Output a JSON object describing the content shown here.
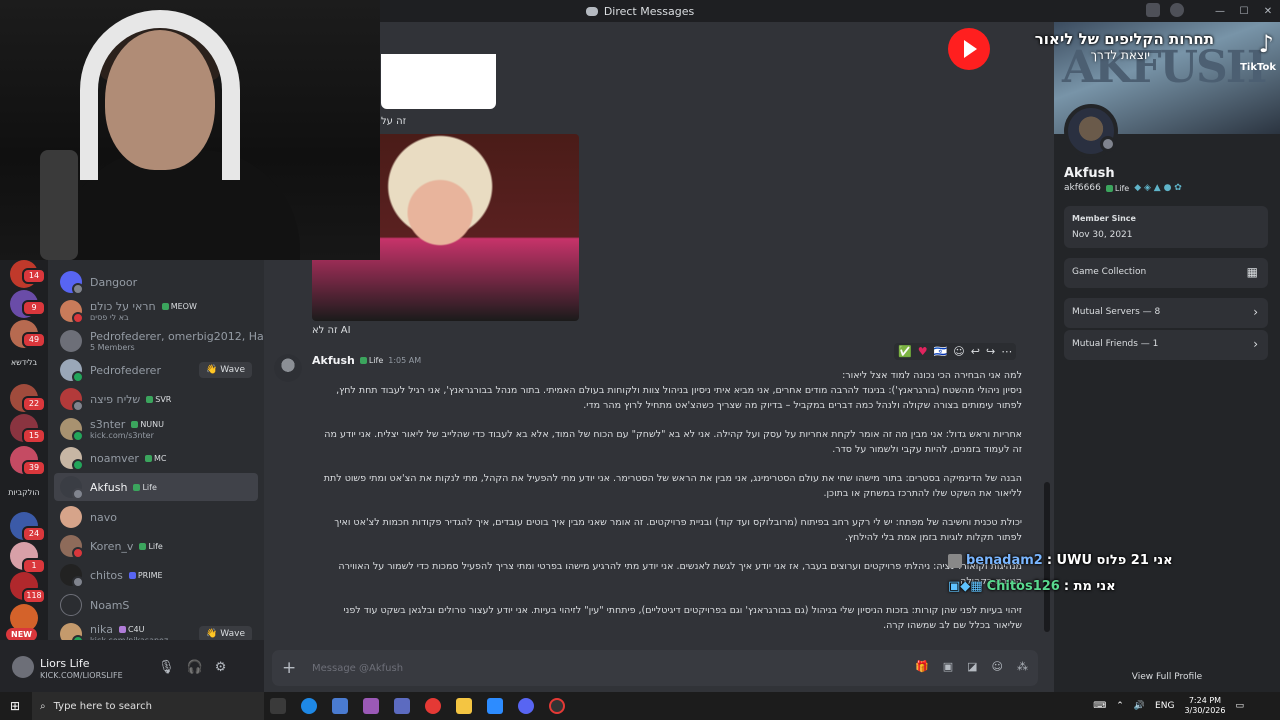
{
  "window": {
    "title": "Direct Messages"
  },
  "rail": {
    "badges": [
      "14",
      "9",
      "49",
      "22",
      "15",
      "39",
      "24",
      "1",
      "118"
    ],
    "labels": [
      "בלידשא",
      "הולקביות"
    ],
    "new_label": "NEW"
  },
  "dms": [
    {
      "name": "Dangoor"
    },
    {
      "name": "חראי על כולם",
      "tag": "MEOW",
      "sub": "בא לי פסים"
    },
    {
      "name": "Pedrofederer, omerbig2012, Hadar...",
      "sub": "5 Members"
    },
    {
      "name": "Pedrofederer",
      "button": "Wave"
    },
    {
      "name": "שליח פיצה",
      "tag": "SVR"
    },
    {
      "name": "s3nter",
      "tag": "NUNU",
      "sub": "kick.com/s3nter"
    },
    {
      "name": "noamver",
      "tag": "MC"
    },
    {
      "name": "Akfush",
      "tag": "Life"
    },
    {
      "name": "navo"
    },
    {
      "name": "Koren_v",
      "tag": "Life"
    },
    {
      "name": "chitos",
      "tag": "PRIME"
    },
    {
      "name": "NoamS"
    },
    {
      "name": "nika",
      "tag": "C4U",
      "sub": "kick.com/nikasapoz",
      "button": "Wave"
    }
  ],
  "user_panel": {
    "name": "Liors Life",
    "status": "KICK.COM/LIORSLIFE"
  },
  "chat": {
    "caption1": "זה על",
    "caption2": "זה לא AI",
    "message": {
      "author": "Akfush",
      "author_tag": "Life",
      "time": "1:05 AM",
      "paragraphs": [
        "למה אני הבחירה הכי נכונה למוד אצל ליאור:",
        "ניסיון ניהולי מהשטח (בורגראנץ'): בניגוד להרבה מודים אחרים, אני מביא איתי ניסיון בניהול צוות ולקוחות בעולם האמיתי. בתור מנהל בבורגראנץ', אני רגיל לעבוד תחת לחץ, לפתור עימותים בצורה שקולה ולנהל כמה דברים במקביל – בדיוק מה שצריך כשהצ'אט מתחיל לרוץ מהר מדי.",
        "אחריות וראש גדול: אני מבין מה זה אומר לקחת אחריות על עסק ועל קהילה. אני לא בא \"לשחק\" עם הכוח של המוד, אלא בא לעבוד כדי שהלייב של ליאור יצליח. אני יודע מה זה לעמוד בזמנים, להיות עקבי ולשמור על סדר.",
        "הבנה של הדינמיקה בסטרים: בתור מישהו שחי את עולם הסטרימינג, אני מבין את הראש של הסטרימר. אני יודע מתי להפעיל את הקהל, מתי לנקות את הצ'אט ומתי פשוט לתת לליאור את השקט שלו להתרכז במשחק או בתוכן.",
        "יכולת טכנית וחשיבה של מפתח: יש לי רקע רחב בפיתוח (מרובלוקס ועד קוד) ובניית פרויקטים. זה אומר שאני מבין איך בוטים עובדים, איך להגדיר פקודות חכמות לצ'אט ואיך לפתור תקלות לוגיות בזמן אמת בלי להילחץ.",
        "מנהיגות וקואורדינציה: ניהלתי פרויקטים וערוצים בעבר, אז אני יודע איך לגשת לאנשים. אני יודע מתי להרגיע מישהו בפרטי ומתי צריך להפעיל סמכות כדי לשמור על האווירה הטובה בקהילה.",
        "זיהוי בעיות לפני שהן קורות: בזכות הניסיון שלי בניהול (גם בבורגראנץ' וגם בפרויקטים דיגיטליים), פיתחתי \"עין\" לזיהוי בעיות. אני יודע לעצור טרולים ובלגאן בשקט עוד לפני שליאור בכלל שם לב שמשהו קרה."
      ]
    },
    "composer_placeholder": "Message @Akfush"
  },
  "profile": {
    "banner_text": "AKFUSH",
    "display_name": "Akfush",
    "username": "akf6666",
    "tag": "Life",
    "member_since_label": "Member Since",
    "member_since": "Nov 30, 2021",
    "game_collection": "Game Collection",
    "mutual_servers": "Mutual Servers — 8",
    "mutual_friends": "Mutual Friends — 1",
    "view_full": "View Full Profile"
  },
  "overlay": {
    "title": "תחרות הקליפים של ליאור",
    "subtitle": "יוצאת לדרך",
    "tiktok": "TikTok",
    "chat": [
      {
        "user": "benadam2",
        "text": ": UWU אני 21 פלוס"
      },
      {
        "user": "Chitos126",
        "text": ": אני מת"
      }
    ]
  },
  "taskbar": {
    "search_placeholder": "Type here to search",
    "lang": "ENG",
    "time": "7:24 PM",
    "date": "3/30/2026"
  },
  "colors": {
    "accent": "#5865f2",
    "online": "#23a55a",
    "danger": "#da373c",
    "background": "#313338"
  }
}
